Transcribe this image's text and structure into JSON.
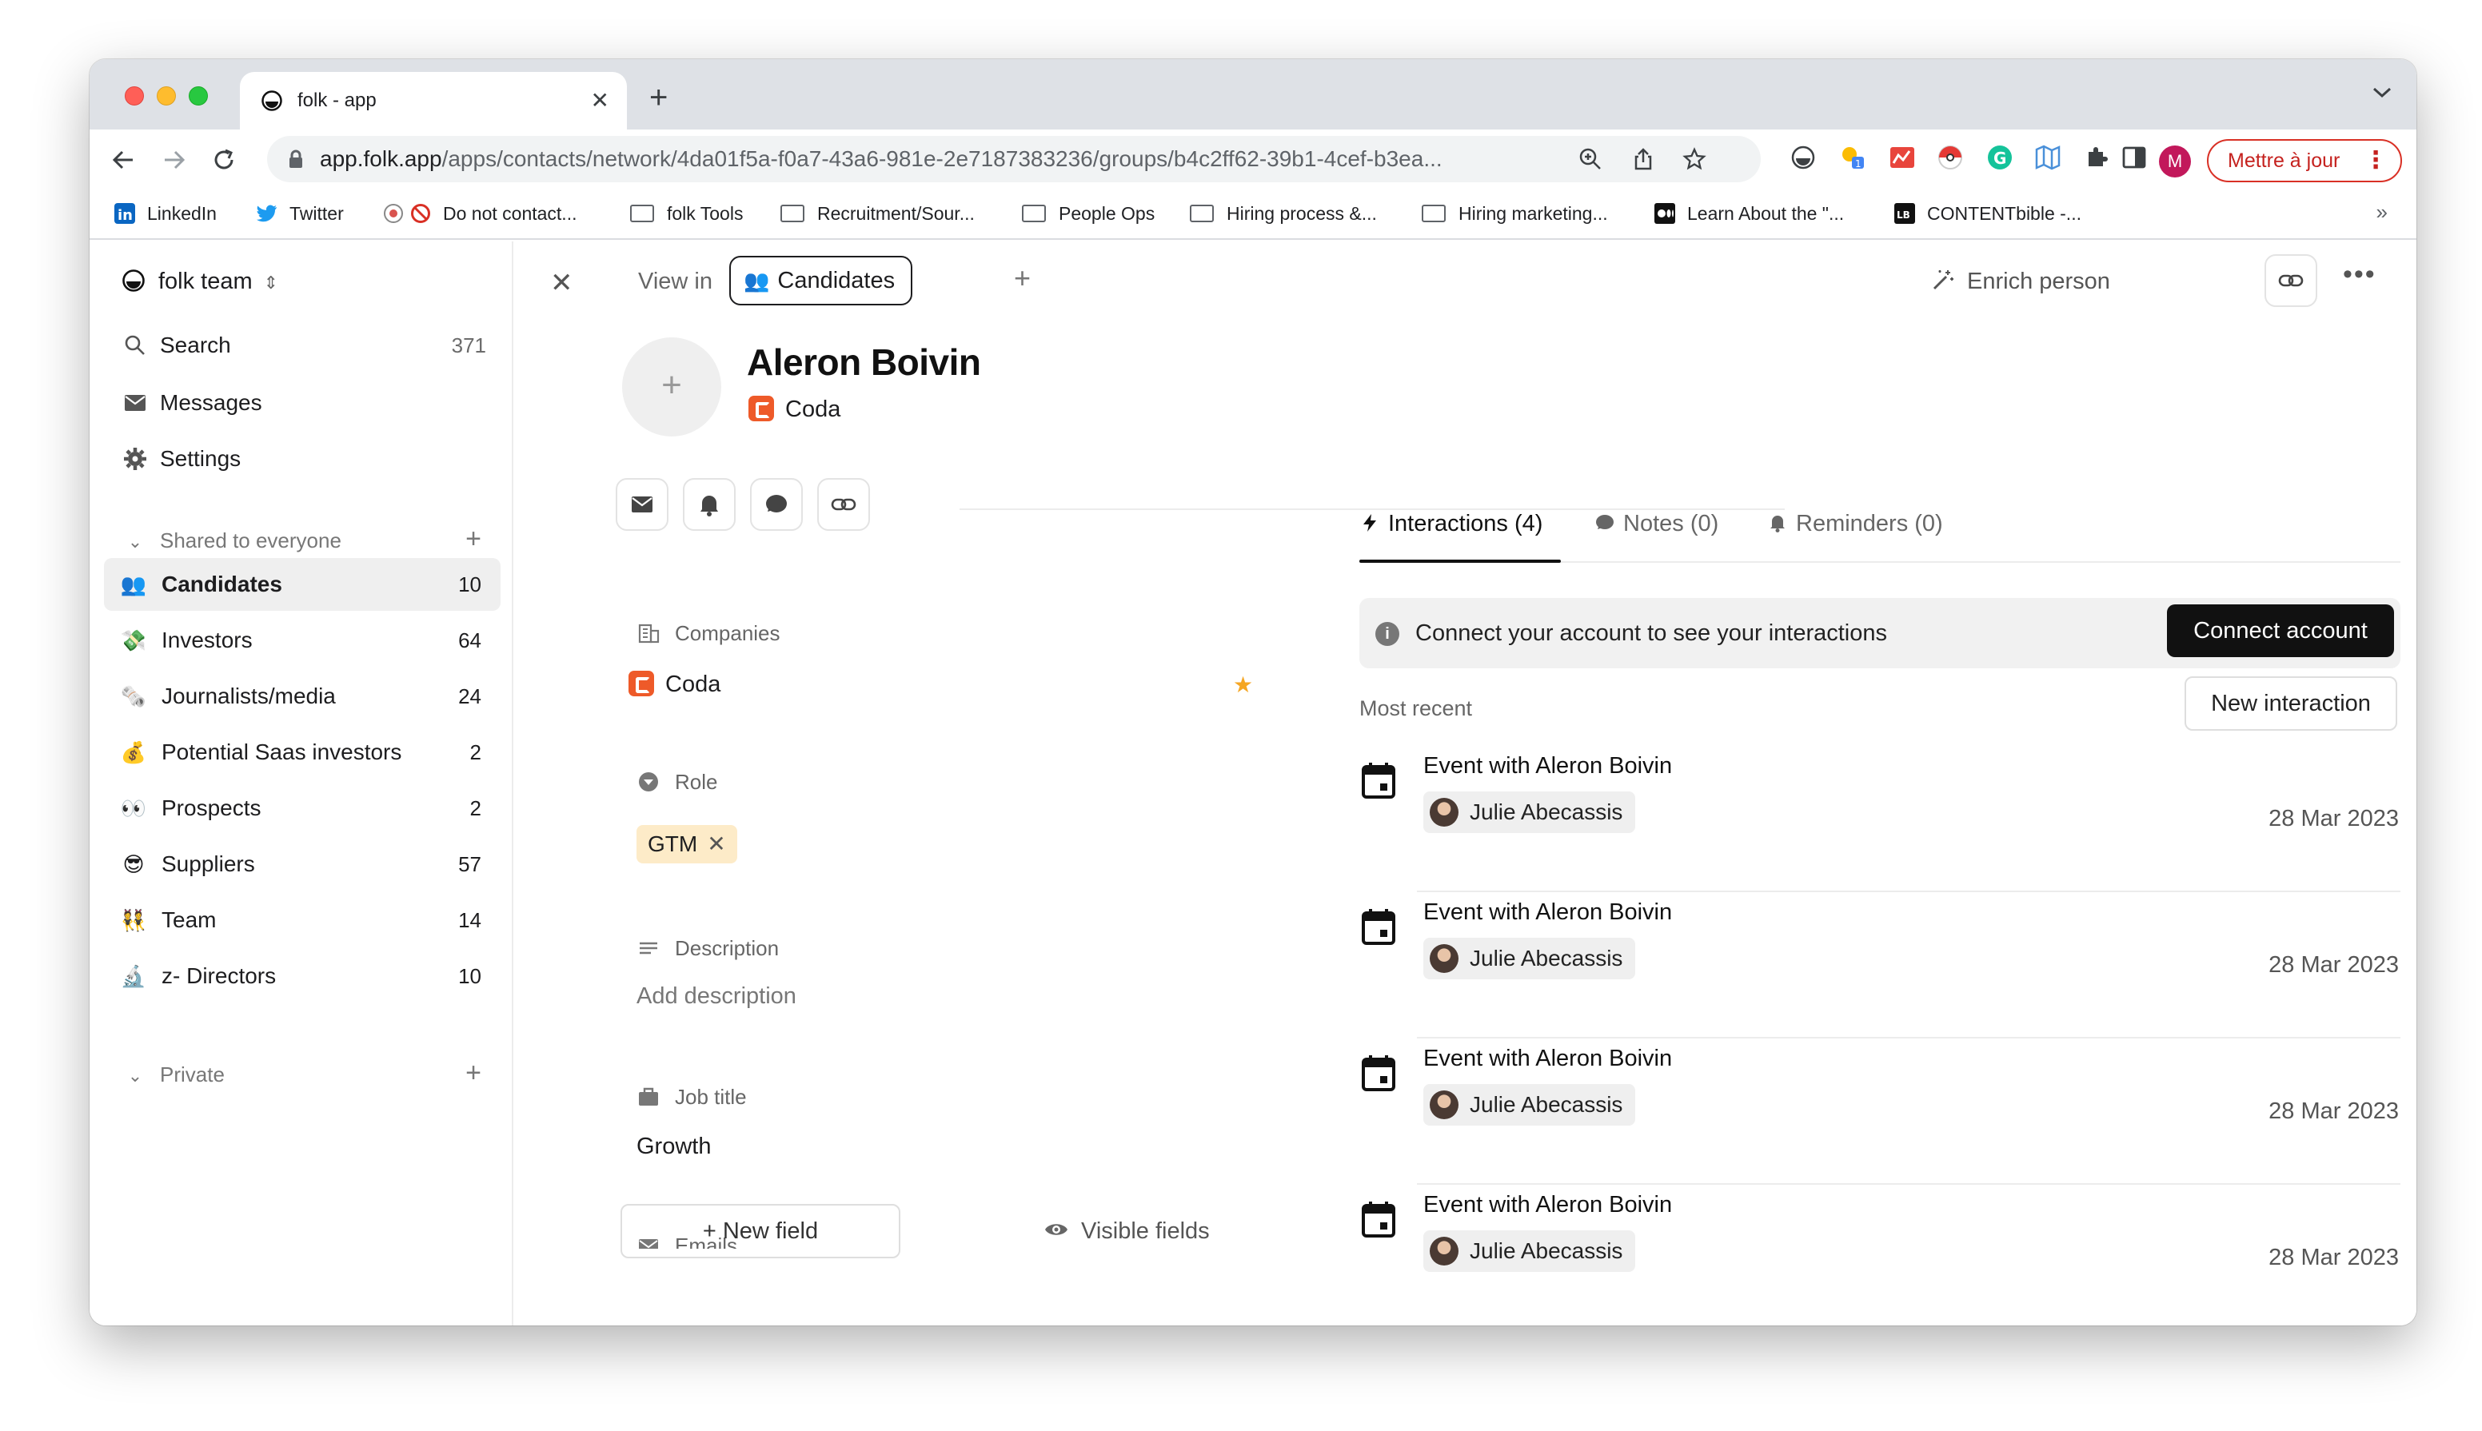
{
  "browser": {
    "tab_title": "folk - app",
    "url_host": "app.folk.app",
    "url_path": "/apps/contacts/network/4da01f5a-f0a7-43a6-981e-2e7187383236/groups/b4c2ff62-39b1-4cef-b3ea...",
    "profile_initial": "M",
    "update_label": "Mettre à jour",
    "bookmarks": [
      {
        "label": "LinkedIn",
        "icon": "linkedin-icon"
      },
      {
        "label": "Twitter",
        "icon": "twitter-icon"
      },
      {
        "label": "Do not contact...",
        "icon": "blocked-icon"
      },
      {
        "label": "folk Tools",
        "icon": "folder-icon"
      },
      {
        "label": "Recruitment/Sour...",
        "icon": "folder-icon"
      },
      {
        "label": "People Ops",
        "icon": "folder-icon"
      },
      {
        "label": "Hiring process &...",
        "icon": "folder-icon"
      },
      {
        "label": "Hiring marketing...",
        "icon": "folder-icon"
      },
      {
        "label": "Learn About the \"...",
        "icon": "medium-icon"
      },
      {
        "label": "CONTENTbible -...",
        "icon": "lb-icon"
      }
    ]
  },
  "sidebar": {
    "workspace": "folk team",
    "nav": [
      {
        "label": "Search",
        "count": "371",
        "icon": "search-icon"
      },
      {
        "label": "Messages",
        "count": "",
        "icon": "mail-icon"
      },
      {
        "label": "Settings",
        "count": "",
        "icon": "gear-icon"
      }
    ],
    "shared_section": "Shared to everyone",
    "groups": [
      {
        "emoji": "👥",
        "label": "Candidates",
        "count": "10"
      },
      {
        "emoji": "💸",
        "label": "Investors",
        "count": "64"
      },
      {
        "emoji": "🗞️",
        "label": "Journalists/media",
        "count": "24"
      },
      {
        "emoji": "💰",
        "label": "Potential Saas investors",
        "count": "2"
      },
      {
        "emoji": "👀",
        "label": "Prospects",
        "count": "2"
      },
      {
        "emoji": "😎",
        "label": "Suppliers",
        "count": "57"
      },
      {
        "emoji": "👯",
        "label": "Team",
        "count": "14"
      },
      {
        "emoji": "🔬",
        "label": "z- Directors",
        "count": "10"
      }
    ],
    "private_section": "Private"
  },
  "header": {
    "view_in": "View in",
    "group_chip": "Candidates",
    "group_emoji": "👥",
    "enrich": "Enrich person"
  },
  "person": {
    "name": "Aleron Boivin",
    "company": "Coda"
  },
  "fields": {
    "companies_label": "Companies",
    "companies_value": "Coda",
    "role_label": "Role",
    "role_tag": "GTM",
    "description_label": "Description",
    "description_placeholder": "Add description",
    "job_title_label": "Job title",
    "job_title_value": "Growth",
    "emails_label": "Emails",
    "new_field": "New field",
    "visible_fields": "Visible fields"
  },
  "right": {
    "tabs": [
      {
        "label": "Interactions (4)",
        "icon": "bolt-icon"
      },
      {
        "label": "Notes (0)",
        "icon": "note-icon"
      },
      {
        "label": "Reminders (0)",
        "icon": "bell-icon"
      }
    ],
    "banner_text": "Connect your account to see your interactions",
    "connect_btn": "Connect account",
    "most_recent": "Most recent",
    "new_interaction": "New interaction",
    "events": [
      {
        "title": "Event with Aleron Boivin",
        "person": "Julie Abecassis",
        "date": "28 Mar 2023"
      },
      {
        "title": "Event with Aleron Boivin",
        "person": "Julie Abecassis",
        "date": "28 Mar 2023"
      },
      {
        "title": "Event with Aleron Boivin",
        "person": "Julie Abecassis",
        "date": "28 Mar 2023"
      },
      {
        "title": "Event with Aleron Boivin",
        "person": "Julie Abecassis",
        "date": "28 Mar 2023"
      }
    ]
  }
}
